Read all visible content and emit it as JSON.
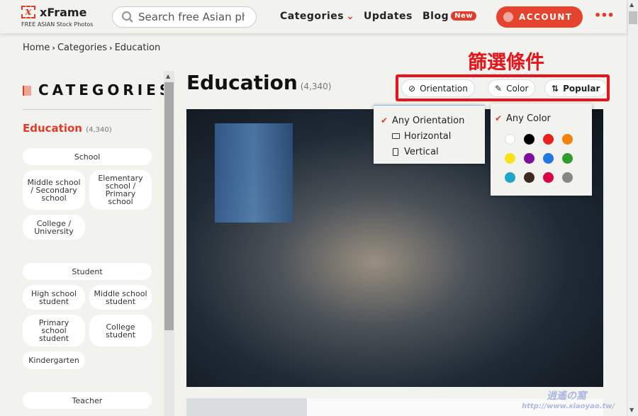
{
  "header": {
    "logo_mark": "x",
    "logo_name": "xFrame",
    "logo_tagline": "FREE ASIAN Stock Photos",
    "search_placeholder": "Search free Asian photos",
    "search_value": "Search free Asian ph",
    "nav": {
      "categories": "Categories",
      "updates": "Updates",
      "blog": "Blog",
      "blog_badge": "New"
    },
    "account": "ACCOUNT",
    "more": "•••"
  },
  "breadcrumb": [
    "Home",
    "Categories",
    "Education"
  ],
  "sidebar": {
    "heading": "CATEGORIES",
    "current": "Education",
    "current_count": "(4,340)",
    "groups": [
      {
        "label": "School",
        "items": [
          "Middle school / Secondary school",
          "Elementary school / Primary school",
          "College / University"
        ]
      },
      {
        "label": "Student",
        "items": [
          "High school student",
          "Middle school student",
          "Primary school student",
          "College student",
          "Kindergarten"
        ]
      },
      {
        "label": "Teacher",
        "items": []
      }
    ]
  },
  "main": {
    "title": "Education",
    "count": "(4,340)",
    "annotation": "篩選條件",
    "filters": {
      "orientation": "Orientation",
      "color": "Color",
      "sort": "Popular"
    },
    "orientation_menu": [
      "Any Orientation",
      "Horizontal",
      "Vertical"
    ],
    "color_menu": {
      "any": "Any Color",
      "swatches": [
        "#ffffff",
        "#000000",
        "#e8201f",
        "#f5820e",
        "#f6e31c",
        "#7f0e9c",
        "#2376e6",
        "#2e9c2e",
        "#1ea5c9",
        "#3e2a1f",
        "#d90647",
        "#868686"
      ]
    }
  },
  "watermark": {
    "name": "逍遙の窩",
    "url": "http://www.xiaoyao.tw/"
  },
  "colors": {
    "accent": "#e5432e",
    "annotation": "#e8141b"
  }
}
